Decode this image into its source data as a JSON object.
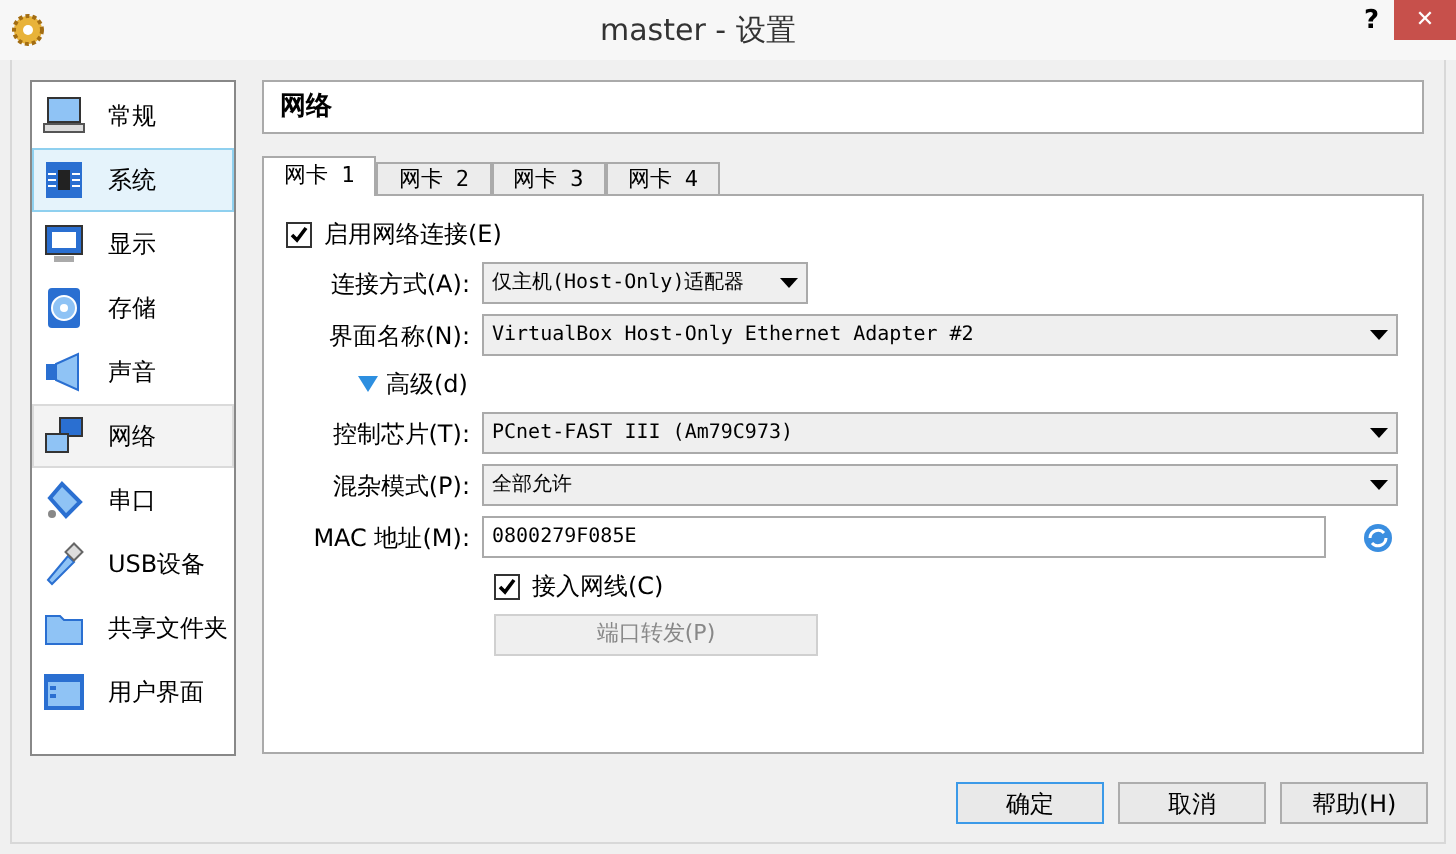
{
  "window": {
    "title": "master - 设置",
    "help": "?",
    "close": "✕"
  },
  "sidebar": {
    "items": [
      {
        "label": "常规",
        "selected": false,
        "hovered": false
      },
      {
        "label": "系统",
        "selected": false,
        "hovered": true
      },
      {
        "label": "显示",
        "selected": false,
        "hovered": false
      },
      {
        "label": "存储",
        "selected": false,
        "hovered": false
      },
      {
        "label": "声音",
        "selected": false,
        "hovered": false
      },
      {
        "label": "网络",
        "selected": true,
        "hovered": false
      },
      {
        "label": "串口",
        "selected": false,
        "hovered": false
      },
      {
        "label": "USB设备",
        "selected": false,
        "hovered": false
      },
      {
        "label": "共享文件夹",
        "selected": false,
        "hovered": false
      },
      {
        "label": "用户界面",
        "selected": false,
        "hovered": false
      }
    ]
  },
  "page_title": "网络",
  "tabs": [
    {
      "label": "网卡 1",
      "selected": true
    },
    {
      "label": "网卡 2",
      "selected": false
    },
    {
      "label": "网卡 3",
      "selected": false
    },
    {
      "label": "网卡 4",
      "selected": false
    }
  ],
  "enable": {
    "label": "启用网络连接(E)",
    "checked": true
  },
  "fields": [
    {
      "kind": "combo",
      "label": "连接方式(A):",
      "value": "仅主机(Host-Only)适配器",
      "wide": false
    },
    {
      "kind": "combo",
      "label": "界面名称(N):",
      "value": "VirtualBox Host-Only Ethernet Adapter #2",
      "wide": true
    },
    {
      "kind": "toggle",
      "label": "高级(d)",
      "expanded": true
    },
    {
      "kind": "combo",
      "label": "控制芯片(T):",
      "value": "PCnet-FAST III (Am79C973)",
      "wide": true
    },
    {
      "kind": "combo",
      "label": "混杂模式(P):",
      "value": "全部允许",
      "wide": true
    },
    {
      "kind": "text",
      "label": "MAC 地址(M):",
      "value": "0800279F085E"
    },
    {
      "kind": "check",
      "label": "接入网线(C)",
      "checked": true
    },
    {
      "kind": "button",
      "label": "端口转发(P)",
      "disabled": true
    }
  ],
  "buttons": [
    {
      "label": "确定",
      "default": true
    },
    {
      "label": "取消",
      "default": false
    },
    {
      "label": "帮助(H)",
      "default": false
    }
  ]
}
